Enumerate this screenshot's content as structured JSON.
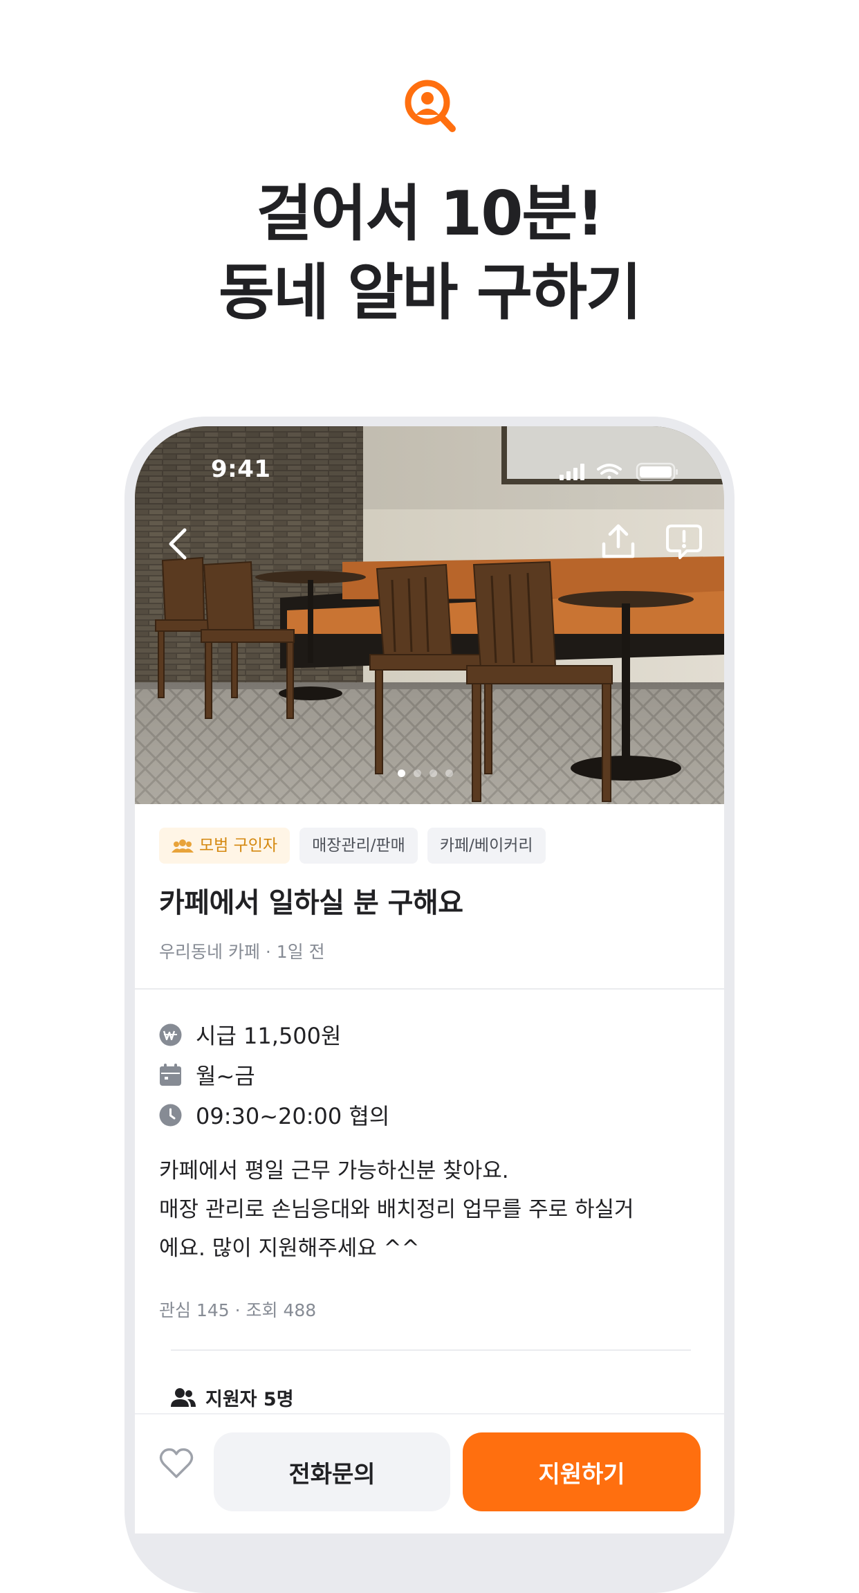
{
  "promo": {
    "headline_line1": "걸어서 10분!",
    "headline_line2": "동네 알바 구하기",
    "logo_icon": "search-person-icon",
    "accent_color": "#ff6f0f"
  },
  "status_bar": {
    "time": "9:41",
    "icons": [
      "signal-icon",
      "wifi-icon",
      "battery-icon"
    ]
  },
  "nav": {
    "back_icon": "chevron-left-icon",
    "share_icon": "share-icon",
    "report_icon": "report-icon"
  },
  "gallery": {
    "page_count": 4,
    "active_page": 1
  },
  "post": {
    "tags": [
      {
        "label": "모범 구인자",
        "icon": "people-badge-icon"
      },
      {
        "label": "매장관리/판매"
      },
      {
        "label": "카페/베이커리"
      }
    ],
    "title": "카페에서 일하실 분 구해요",
    "meta": "우리동네 카페 · 1일 전",
    "wage": "시급 11,500원",
    "days": "월~금",
    "hours": "09:30~20:00 협의",
    "description_lines": [
      "카페에서 평일 근무 가능하신분 찾아요.",
      "매장 관리로 손님응대와 배치정리 업무를 주로 하실거",
      "에요. 많이 지원해주세요 ^^"
    ],
    "stats": "관심 145 · 조회 488",
    "applicants_label": "지원자 5명"
  },
  "actions": {
    "call_label": "전화문의",
    "apply_label": "지원하기"
  }
}
